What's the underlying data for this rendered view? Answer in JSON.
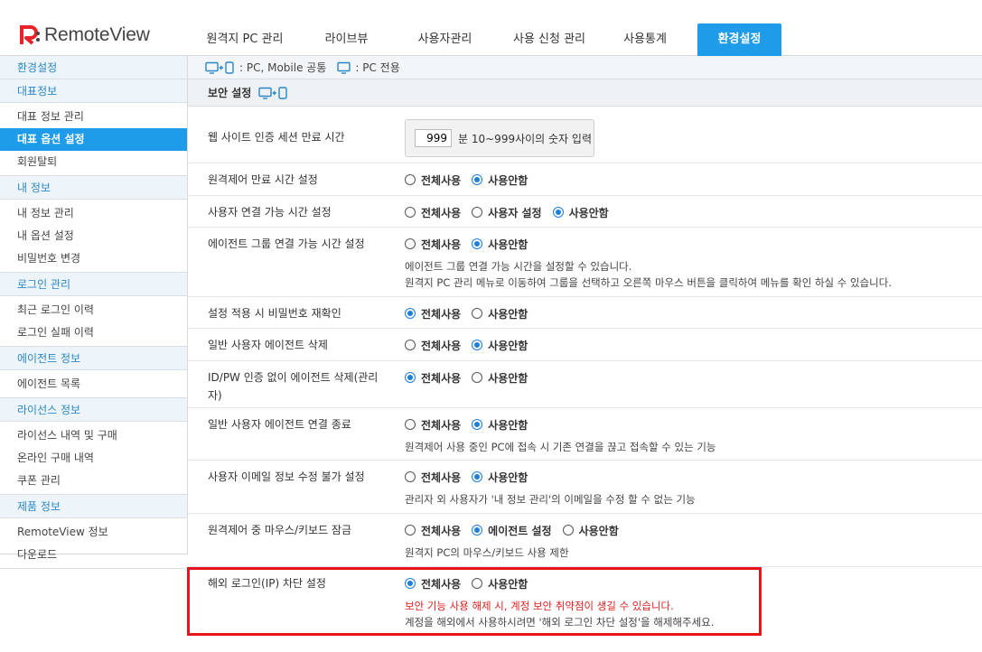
{
  "app": {
    "logo_text": "RemoteView"
  },
  "nav": {
    "tabs": [
      {
        "label": "원격지 PC 관리"
      },
      {
        "label": "라이브뷰"
      },
      {
        "label": "사용자관리"
      },
      {
        "label": "사용 신청 관리"
      },
      {
        "label": "사용통계"
      },
      {
        "label": "환경설정"
      }
    ],
    "active_index": 5
  },
  "sidebar": {
    "top": "환경설정",
    "sections": [
      {
        "title": "대표정보",
        "items": [
          "대표 정보 관리",
          "대표 옵션 설정",
          "회원탈퇴"
        ]
      },
      {
        "title": "내 정보",
        "items": [
          "내 정보 관리",
          "내 옵션 설정",
          "비밀번호 변경"
        ]
      },
      {
        "title": "로그인 관리",
        "items": [
          "최근 로그인 이력",
          "로그인 실패 이력"
        ]
      },
      {
        "title": "에이전트 정보",
        "items": [
          "에이전트 목록"
        ]
      },
      {
        "title": "라이선스 정보",
        "items": [
          "라이선스 내역 및 구매",
          "온라인 구매 내역",
          "쿠폰 관리"
        ]
      },
      {
        "title": "제품 정보",
        "items": [
          "RemoteView 정보",
          "다운로드"
        ]
      }
    ],
    "active_item": "대표 옵션 설정"
  },
  "legend": {
    "common_label": ": PC, Mobile 공통",
    "pc_label": ": PC 전용"
  },
  "section_title": "보안 설정",
  "session": {
    "label": "웹 사이트 인증 세션 만료 시간",
    "value": "999",
    "hint": "분 10~999사이의 숫자 입력"
  },
  "settings": [
    {
      "label": "원격제어 만료 시간 설정",
      "options": [
        "전체사용",
        "사용안함"
      ],
      "selected": 1,
      "desc": []
    },
    {
      "label": "사용자 연결 가능 시간 설정",
      "options": [
        "전체사용",
        "사용자 설정",
        "사용안함"
      ],
      "selected": 2,
      "desc": []
    },
    {
      "label": "에이전트 그룹 연결 가능 시간 설정",
      "options": [
        "전체사용",
        "사용안함"
      ],
      "selected": 1,
      "desc": [
        "에이전트 그룹 연결 가능 시간을 설정할 수 있습니다.",
        "원격지 PC 관리 메뉴로 이동하여 그룹을 선택하고 오른쪽 마우스 버튼을 클릭하여 메뉴를 확인 하실 수 있습니다."
      ]
    },
    {
      "label": "설정 적용 시 비밀번호 재확인",
      "options": [
        "전체사용",
        "사용안함"
      ],
      "selected": 0,
      "desc": []
    },
    {
      "label": "일반 사용자 에이전트 삭제",
      "options": [
        "전체사용",
        "사용안함"
      ],
      "selected": 1,
      "desc": []
    },
    {
      "label": "ID/PW 인증 없이 에이전트 삭제(관리자)",
      "options": [
        "전체사용",
        "사용안함"
      ],
      "selected": 0,
      "desc": []
    },
    {
      "label": "일반 사용자 에이전트 연결 종료",
      "options": [
        "전체사용",
        "사용안함"
      ],
      "selected": 1,
      "desc": [
        "원격제어 사용 중인 PC에 접속 시 기존 연결을 끊고 접속할 수 있는 기능"
      ]
    },
    {
      "label": "사용자 이메일 정보 수정 불가 설정",
      "options": [
        "전체사용",
        "사용안함"
      ],
      "selected": 1,
      "desc": [
        "관리자 외 사용자가 '내 정보 관리'의 이메일을 수정 할 수 없는 기능"
      ]
    },
    {
      "label": "원격제어 중 마우스/키보드 잠금",
      "options": [
        "전체사용",
        "에이전트 설정",
        "사용안함"
      ],
      "selected": 1,
      "desc": [
        "원격지 PC의 마우스/키보드 사용 제한"
      ]
    },
    {
      "label": "해외 로그인(IP) 차단 설정",
      "options": [
        "전체사용",
        "사용안함"
      ],
      "selected": 0,
      "warn": "보안 기능 사용 해제 시, 계정 보안 취약점이 생길 수 있습니다.",
      "desc": [
        "계정을 해외에서 사용하시려면 '해외 로그인 차단 설정'을 해제해주세요."
      ]
    }
  ],
  "colors": {
    "accent": "#1e9be9",
    "highlight": "#e8141b",
    "warn": "#e02020",
    "logo_red": "#e8232a"
  }
}
